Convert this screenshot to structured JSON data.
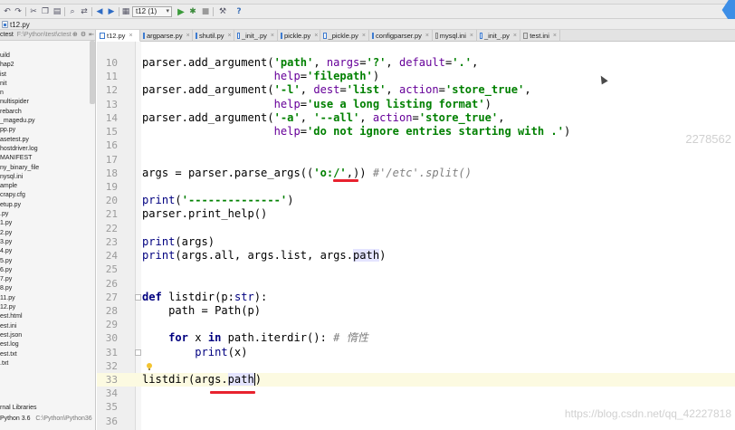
{
  "toolbar": {
    "run_config": "t12 (1)"
  },
  "navbar": {
    "breadcrumb": "t12.py"
  },
  "project": {
    "root_name": "ctest",
    "root_path": "F:\\Python\\test\\ctest",
    "items": [
      "uild",
      "hap2",
      "ist",
      "nit",
      "n",
      "nultispider",
      "rebarch",
      "_magedu.py",
      "pp.py",
      "asetest.py",
      "hostdriver.log",
      "MANIFEST",
      "ny_binary_file",
      "nysql.ini",
      "ample",
      "crapy.cfg",
      "etup.py",
      ".py",
      "1.py",
      "2.py",
      "3.py",
      "4.py",
      "5.py",
      "6.py",
      "7.py",
      "8.py",
      "11.py",
      "12.py",
      "est.html",
      "est.ini",
      "est.json",
      "est.log",
      "est.txt",
      ".txt"
    ],
    "libraries": "rnal Libraries",
    "sdk_name": "Python 3.6",
    "sdk_path": "C:\\Python\\Python36"
  },
  "tabs": [
    {
      "label": "t12.py",
      "kind": "py"
    },
    {
      "label": "argparse.py",
      "kind": "py"
    },
    {
      "label": "shutil.py",
      "kind": "py"
    },
    {
      "label": "_init_.py",
      "kind": "py"
    },
    {
      "label": "pickle.py",
      "kind": "py"
    },
    {
      "label": "_pickle.py",
      "kind": "py"
    },
    {
      "label": "configparser.py",
      "kind": "py"
    },
    {
      "label": "mysql.ini",
      "kind": "ini"
    },
    {
      "label": "_init_.py",
      "kind": "py"
    },
    {
      "label": "test.ini",
      "kind": "ini"
    }
  ],
  "editor": {
    "line_numbers": [
      "10",
      "11",
      "12",
      "13",
      "14",
      "15",
      "16",
      "17",
      "18",
      "19",
      "20",
      "21",
      "22",
      "23",
      "24",
      "25",
      "26",
      "27",
      "28",
      "29",
      "30",
      "31",
      "32",
      "33",
      "34",
      "35",
      "36"
    ],
    "current_line": "33"
  },
  "watermarks": {
    "top": "2278562",
    "bottom": "https://blog.csdn.net/qq_42227818"
  }
}
